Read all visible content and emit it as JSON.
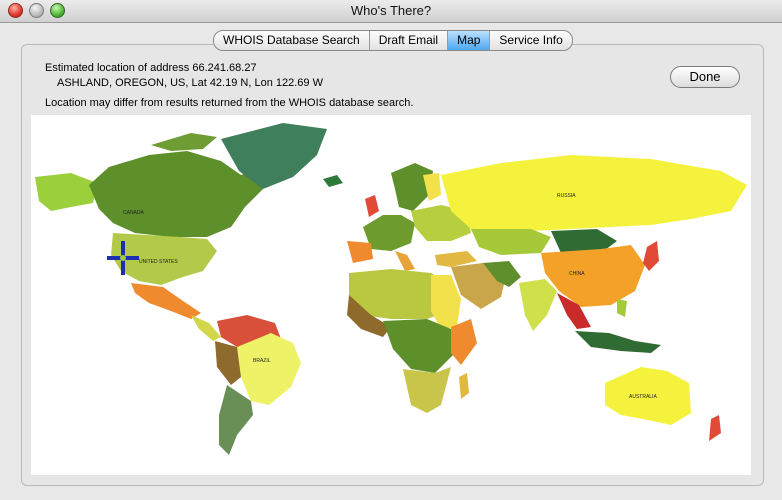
{
  "window": {
    "title": "Who's There?"
  },
  "tabs": [
    {
      "label": "WHOIS Database Search",
      "active": false
    },
    {
      "label": "Draft Email",
      "active": false
    },
    {
      "label": "Map",
      "active": true
    },
    {
      "label": "Service Info",
      "active": false
    }
  ],
  "location": {
    "line1": "Estimated location of address 66.241.68.27",
    "line2": "ASHLAND, OREGON, US, Lat 42.19 N, Lon 122.69 W",
    "note": "Location may differ from results returned from the WHOIS database search."
  },
  "buttons": {
    "done": "Done"
  },
  "map": {
    "labels": {
      "canada": "CANADA",
      "united_states": "UNITED STATES",
      "brazil": "BRAZIL",
      "russia": "RUSSIA",
      "china": "CHINA",
      "australia": "AUSTRALIA"
    },
    "marker_color": "#1b2fb0"
  }
}
